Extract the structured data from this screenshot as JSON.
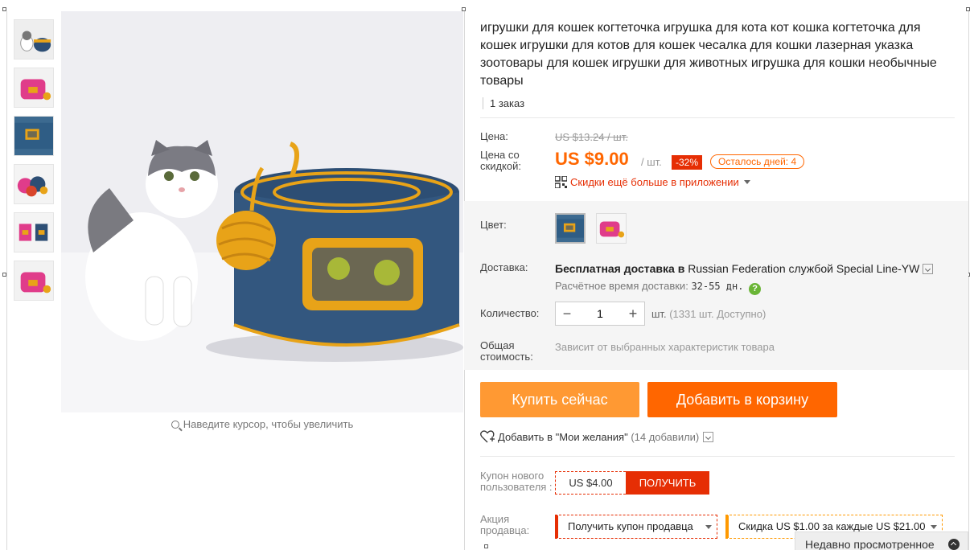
{
  "product": {
    "title": "игрушки для кошек когтеточка игрушка для кота кот кошка когтеточка для кошек игрушки для котов для кошек чесалка для кошки лазерная указка зоотовары для кошек игрушки для животных игрушка для кошки необычные товары",
    "orders": "1 заказ"
  },
  "gallery": {
    "zoom_hint": "Наведите курсор, чтобы увеличить",
    "thumbnail_count": 6
  },
  "price": {
    "label": "Цена:",
    "old": "US $13.24 / шт.",
    "discount_label": "Цена со скидкой:",
    "current": "US $9.00",
    "per_unit": "/ шт.",
    "discount_badge": "-32%",
    "days_left": "Осталось дней: 4",
    "app_promo": "Скидки ещё больше в приложении"
  },
  "options": {
    "color_label": "Цвет:",
    "shipping_label": "Доставка:",
    "shipping_bold": "Бесплатная доставка в",
    "shipping_dest": " Russian Federation службой Special Line-YW",
    "delivery_time_label": "Расчётное время доставки:",
    "delivery_time_value": "32-55 дн.",
    "quantity_label": "Количество:",
    "quantity_value": "1",
    "quantity_unit": "шт.",
    "quantity_available": "(1331 шт. Доступно)",
    "total_label": "Общая стоимость:",
    "total_note": "Зависит от выбранных характеристик товара"
  },
  "actions": {
    "buy_now": "Купить сейчас",
    "add_to_cart": "Добавить в корзину",
    "wishlist": "Добавить в \"Мои желания\"",
    "wishlist_count": "(14 добавили)"
  },
  "coupons": {
    "new_user_label": "Купон нового пользователя :",
    "new_user_value": "US $4.00",
    "get_button": "ПОЛУЧИТЬ",
    "seller_promo_label": "Акция продавца:",
    "seller_coupon": "Получить купон продавца",
    "seller_discount": "Скидка US $1.00 за каждые US $21.00"
  },
  "recently_viewed": "Недавно просмотренное",
  "colors": {
    "accent_orange": "#ff6600",
    "buy_orange": "#ff9933",
    "red": "#e62e04"
  }
}
